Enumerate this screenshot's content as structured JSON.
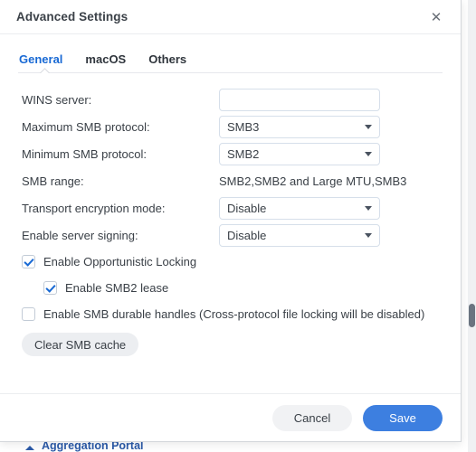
{
  "dialog": {
    "title": "Advanced Settings",
    "close_icon": "close-icon"
  },
  "tabs": [
    {
      "label": "General",
      "active": true
    },
    {
      "label": "macOS",
      "active": false
    },
    {
      "label": "Others",
      "active": false
    }
  ],
  "form": {
    "wins_server": {
      "label": "WINS server:",
      "value": "",
      "placeholder": ""
    },
    "maximum_smb_protocol": {
      "label": "Maximum SMB protocol:",
      "value": "SMB3"
    },
    "minimum_smb_protocol": {
      "label": "Minimum SMB protocol:",
      "value": "SMB2"
    },
    "smb_range": {
      "label": "SMB range:",
      "value": "SMB2,SMB2 and Large MTU,SMB3"
    },
    "transport_encryption_mode": {
      "label": "Transport encryption mode:",
      "value": "Disable"
    },
    "enable_server_signing": {
      "label": "Enable server signing:",
      "value": "Disable"
    }
  },
  "checkboxes": {
    "opportunistic_locking": {
      "label": "Enable Opportunistic Locking",
      "checked": true
    },
    "smb2_lease": {
      "label": "Enable SMB2 lease",
      "checked": true
    },
    "smb_durable_handles": {
      "label": "Enable SMB durable handles (Cross-protocol file locking will be disabled)",
      "checked": false
    }
  },
  "actions": {
    "clear_smb_cache": "Clear SMB cache",
    "cancel": "Cancel",
    "save": "Save"
  },
  "background": {
    "bottom_item_label": "Aggregation Portal"
  },
  "colors": {
    "accent_blue": "#1869d4",
    "primary_button": "#3d7fe0",
    "background_link": "#2b5aa8",
    "text": "#3a4047"
  }
}
